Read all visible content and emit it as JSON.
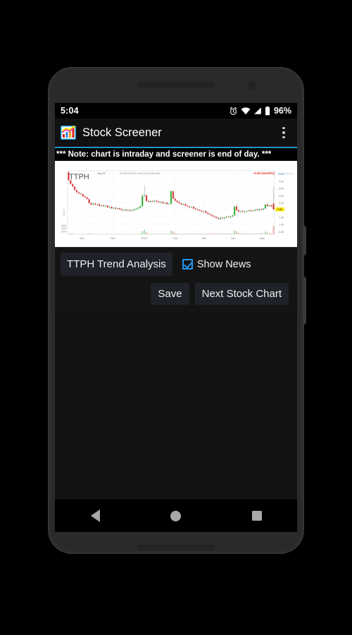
{
  "status_bar": {
    "clock": "5:04",
    "battery_percent": "96%",
    "icons": [
      "alarm-icon",
      "wifi-icon",
      "signal-icon",
      "battery-icon"
    ]
  },
  "app_bar": {
    "title": "Stock Screener",
    "app_icon": "stock-screener-app-icon",
    "overflow_icon": "overflow-menu-icon"
  },
  "note": {
    "text": "*** Note: chart is intraday and screener is end of day. ***",
    "accent_color": "#2196c4"
  },
  "controls": {
    "trend_analysis_label": "TTPH Trend Analysis",
    "show_news_label": "Show News",
    "show_news_checked": true,
    "save_label": "Save",
    "next_stock_chart_label": "Next Stock Chart",
    "checkbox_color": "#2196f3"
  },
  "nav_bar": {
    "back": "back-nav-icon",
    "home": "home-nav-icon",
    "recents": "recents-nav-icon"
  },
  "chart_data": {
    "type": "candlestick",
    "title": "TTPH",
    "subtitle": "DAILY",
    "quote_date": "May 08",
    "ohlc_label": "O:2.15  H:2.20  L:1.94  C:2.02  Vol:4.2M",
    "change_label": "-0.40 (16.53%)",
    "change_color": "#e03030",
    "source_label": "StockCharts.com",
    "last_price": "2.02",
    "price_axis_label": "Price",
    "price_ticks": [
      "4.50",
      "4.00",
      "3.50",
      "3.00",
      "2.50",
      "2.00",
      "1.50",
      "1.00",
      "0.50"
    ],
    "price_tick_values": [
      4.5,
      4.0,
      3.5,
      3.0,
      2.5,
      2.0,
      1.5,
      1.0,
      0.5
    ],
    "ylim": [
      0.3,
      4.7
    ],
    "volume_ticks": [
      "60M",
      "40M",
      "20M"
    ],
    "volume_tick_values": [
      60,
      40,
      20
    ],
    "x_tick_labels": [
      "Nov",
      "Dec",
      "2020",
      "Feb",
      "Mar",
      "Apr",
      "May"
    ],
    "x_tick_positions": [
      0.07,
      0.22,
      0.37,
      0.52,
      0.66,
      0.8,
      0.94
    ],
    "grid": true,
    "up_color": "#15a81c",
    "down_color": "#e02020",
    "candles": [
      {
        "o": 4.6,
        "h": 4.7,
        "l": 3.95,
        "c": 4.05
      },
      {
        "o": 4.05,
        "h": 4.1,
        "l": 3.7,
        "c": 3.78
      },
      {
        "o": 3.78,
        "h": 3.85,
        "l": 3.55,
        "c": 3.6
      },
      {
        "o": 3.6,
        "h": 3.66,
        "l": 3.3,
        "c": 3.36
      },
      {
        "o": 3.36,
        "h": 3.42,
        "l": 3.15,
        "c": 3.2
      },
      {
        "o": 3.2,
        "h": 3.28,
        "l": 3.05,
        "c": 3.12
      },
      {
        "o": 3.12,
        "h": 3.2,
        "l": 2.98,
        "c": 3.08
      },
      {
        "o": 3.08,
        "h": 3.15,
        "l": 2.88,
        "c": 2.92
      },
      {
        "o": 2.92,
        "h": 3.0,
        "l": 2.8,
        "c": 2.85
      },
      {
        "o": 2.85,
        "h": 2.95,
        "l": 2.7,
        "c": 2.74
      },
      {
        "o": 2.74,
        "h": 2.82,
        "l": 2.4,
        "c": 2.46
      },
      {
        "o": 2.46,
        "h": 2.55,
        "l": 2.3,
        "c": 2.36
      },
      {
        "o": 2.36,
        "h": 2.48,
        "l": 2.28,
        "c": 2.42
      },
      {
        "o": 2.42,
        "h": 2.5,
        "l": 2.3,
        "c": 2.34
      },
      {
        "o": 2.34,
        "h": 2.44,
        "l": 2.26,
        "c": 2.38
      },
      {
        "o": 2.38,
        "h": 2.46,
        "l": 2.22,
        "c": 2.26
      },
      {
        "o": 2.26,
        "h": 2.36,
        "l": 2.18,
        "c": 2.3
      },
      {
        "o": 2.3,
        "h": 2.38,
        "l": 2.2,
        "c": 2.24
      },
      {
        "o": 2.24,
        "h": 2.34,
        "l": 2.14,
        "c": 2.28
      },
      {
        "o": 2.28,
        "h": 2.35,
        "l": 2.12,
        "c": 2.16
      },
      {
        "o": 2.16,
        "h": 2.26,
        "l": 2.08,
        "c": 2.2
      },
      {
        "o": 2.2,
        "h": 2.28,
        "l": 2.05,
        "c": 2.09
      },
      {
        "o": 2.09,
        "h": 2.18,
        "l": 2.0,
        "c": 2.13
      },
      {
        "o": 2.13,
        "h": 2.22,
        "l": 2.02,
        "c": 2.06
      },
      {
        "o": 2.06,
        "h": 2.14,
        "l": 1.96,
        "c": 2.1
      },
      {
        "o": 2.1,
        "h": 2.18,
        "l": 1.98,
        "c": 2.02
      },
      {
        "o": 2.02,
        "h": 2.1,
        "l": 1.92,
        "c": 1.96
      },
      {
        "o": 1.96,
        "h": 2.04,
        "l": 1.88,
        "c": 2.0
      },
      {
        "o": 2.0,
        "h": 2.08,
        "l": 1.9,
        "c": 1.94
      },
      {
        "o": 1.94,
        "h": 2.02,
        "l": 1.86,
        "c": 1.98
      },
      {
        "o": 1.98,
        "h": 2.06,
        "l": 1.88,
        "c": 1.92
      },
      {
        "o": 1.92,
        "h": 2.0,
        "l": 1.84,
        "c": 1.96
      },
      {
        "o": 1.96,
        "h": 2.06,
        "l": 1.9,
        "c": 2.02
      },
      {
        "o": 2.02,
        "h": 2.12,
        "l": 1.96,
        "c": 2.08
      },
      {
        "o": 2.08,
        "h": 2.2,
        "l": 2.02,
        "c": 2.14
      },
      {
        "o": 2.14,
        "h": 2.28,
        "l": 2.08,
        "c": 2.24
      },
      {
        "o": 2.24,
        "h": 3.1,
        "l": 2.18,
        "c": 2.95
      },
      {
        "o": 2.95,
        "h": 3.7,
        "l": 2.88,
        "c": 3.0
      },
      {
        "o": 3.0,
        "h": 3.1,
        "l": 2.55,
        "c": 2.6
      },
      {
        "o": 2.6,
        "h": 2.7,
        "l": 2.48,
        "c": 2.54
      },
      {
        "o": 2.54,
        "h": 2.66,
        "l": 2.46,
        "c": 2.6
      },
      {
        "o": 2.6,
        "h": 2.7,
        "l": 2.5,
        "c": 2.56
      },
      {
        "o": 2.56,
        "h": 2.66,
        "l": 2.46,
        "c": 2.62
      },
      {
        "o": 2.62,
        "h": 2.72,
        "l": 2.52,
        "c": 2.56
      },
      {
        "o": 2.56,
        "h": 2.64,
        "l": 2.44,
        "c": 2.5
      },
      {
        "o": 2.5,
        "h": 2.6,
        "l": 2.42,
        "c": 2.54
      },
      {
        "o": 2.54,
        "h": 2.62,
        "l": 2.4,
        "c": 2.44
      },
      {
        "o": 2.44,
        "h": 2.54,
        "l": 2.36,
        "c": 2.48
      },
      {
        "o": 2.48,
        "h": 2.58,
        "l": 2.34,
        "c": 2.38
      },
      {
        "o": 2.38,
        "h": 2.48,
        "l": 2.3,
        "c": 2.42
      },
      {
        "o": 2.42,
        "h": 3.4,
        "l": 2.36,
        "c": 3.28
      },
      {
        "o": 3.28,
        "h": 3.36,
        "l": 2.7,
        "c": 2.76
      },
      {
        "o": 2.76,
        "h": 2.86,
        "l": 2.58,
        "c": 2.62
      },
      {
        "o": 2.62,
        "h": 2.7,
        "l": 2.48,
        "c": 2.52
      },
      {
        "o": 2.52,
        "h": 2.62,
        "l": 2.4,
        "c": 2.44
      },
      {
        "o": 2.44,
        "h": 2.52,
        "l": 2.32,
        "c": 2.36
      },
      {
        "o": 2.36,
        "h": 2.46,
        "l": 2.28,
        "c": 2.4
      },
      {
        "o": 2.4,
        "h": 2.48,
        "l": 2.24,
        "c": 2.28
      },
      {
        "o": 2.28,
        "h": 2.38,
        "l": 2.18,
        "c": 2.22
      },
      {
        "o": 2.22,
        "h": 2.32,
        "l": 2.12,
        "c": 2.16
      },
      {
        "o": 2.16,
        "h": 2.26,
        "l": 2.08,
        "c": 2.2
      },
      {
        "o": 2.2,
        "h": 2.28,
        "l": 2.04,
        "c": 2.08
      },
      {
        "o": 2.08,
        "h": 2.16,
        "l": 1.98,
        "c": 2.02
      },
      {
        "o": 2.02,
        "h": 2.12,
        "l": 1.94,
        "c": 1.98
      },
      {
        "o": 1.98,
        "h": 2.06,
        "l": 1.88,
        "c": 1.92
      },
      {
        "o": 1.92,
        "h": 2.0,
        "l": 1.82,
        "c": 1.86
      },
      {
        "o": 1.86,
        "h": 1.96,
        "l": 1.78,
        "c": 1.9
      },
      {
        "o": 1.9,
        "h": 1.98,
        "l": 1.74,
        "c": 1.78
      },
      {
        "o": 1.78,
        "h": 1.86,
        "l": 1.66,
        "c": 1.7
      },
      {
        "o": 1.7,
        "h": 1.8,
        "l": 1.6,
        "c": 1.64
      },
      {
        "o": 1.64,
        "h": 1.72,
        "l": 1.52,
        "c": 1.56
      },
      {
        "o": 1.56,
        "h": 1.66,
        "l": 1.46,
        "c": 1.5
      },
      {
        "o": 1.5,
        "h": 1.6,
        "l": 1.38,
        "c": 1.42
      },
      {
        "o": 1.42,
        "h": 1.52,
        "l": 1.32,
        "c": 1.36
      },
      {
        "o": 1.36,
        "h": 1.48,
        "l": 1.28,
        "c": 1.44
      },
      {
        "o": 1.44,
        "h": 1.54,
        "l": 1.36,
        "c": 1.4
      },
      {
        "o": 1.4,
        "h": 1.5,
        "l": 1.3,
        "c": 1.46
      },
      {
        "o": 1.46,
        "h": 1.58,
        "l": 1.4,
        "c": 1.52
      },
      {
        "o": 1.52,
        "h": 1.62,
        "l": 1.44,
        "c": 1.48
      },
      {
        "o": 1.48,
        "h": 1.58,
        "l": 1.38,
        "c": 1.54
      },
      {
        "o": 1.54,
        "h": 1.66,
        "l": 1.48,
        "c": 1.6
      },
      {
        "o": 1.6,
        "h": 2.3,
        "l": 1.56,
        "c": 2.22
      },
      {
        "o": 2.22,
        "h": 2.4,
        "l": 1.9,
        "c": 1.96
      },
      {
        "o": 1.96,
        "h": 2.06,
        "l": 1.82,
        "c": 1.86
      },
      {
        "o": 1.86,
        "h": 1.96,
        "l": 1.74,
        "c": 1.9
      },
      {
        "o": 1.9,
        "h": 2.0,
        "l": 1.8,
        "c": 1.84
      },
      {
        "o": 1.84,
        "h": 1.94,
        "l": 1.76,
        "c": 1.88
      },
      {
        "o": 1.88,
        "h": 1.98,
        "l": 1.8,
        "c": 1.92
      },
      {
        "o": 1.92,
        "h": 2.02,
        "l": 1.84,
        "c": 1.96
      },
      {
        "o": 1.96,
        "h": 2.04,
        "l": 1.86,
        "c": 1.9
      },
      {
        "o": 1.9,
        "h": 2.0,
        "l": 1.82,
        "c": 1.94
      },
      {
        "o": 1.94,
        "h": 2.06,
        "l": 1.88,
        "c": 2.0
      },
      {
        "o": 2.0,
        "h": 2.1,
        "l": 1.92,
        "c": 1.96
      },
      {
        "o": 1.96,
        "h": 2.08,
        "l": 1.9,
        "c": 2.04
      },
      {
        "o": 2.04,
        "h": 2.14,
        "l": 1.96,
        "c": 2.0
      },
      {
        "o": 2.0,
        "h": 2.12,
        "l": 1.94,
        "c": 2.08
      },
      {
        "o": 2.08,
        "h": 2.42,
        "l": 2.02,
        "c": 2.36
      },
      {
        "o": 2.36,
        "h": 2.5,
        "l": 2.2,
        "c": 2.26
      },
      {
        "o": 2.26,
        "h": 2.36,
        "l": 2.14,
        "c": 2.3
      },
      {
        "o": 2.3,
        "h": 2.4,
        "l": 2.18,
        "c": 2.22
      },
      {
        "o": 2.42,
        "h": 3.6,
        "l": 2.0,
        "c": 2.02
      }
    ],
    "volumes": [
      4,
      6,
      3,
      3,
      2,
      2,
      2,
      3,
      2,
      2,
      5,
      4,
      3,
      2,
      2,
      3,
      2,
      2,
      2,
      3,
      2,
      2,
      2,
      2,
      2,
      2,
      3,
      2,
      2,
      2,
      2,
      2,
      2,
      3,
      3,
      4,
      22,
      30,
      14,
      6,
      4,
      3,
      3,
      4,
      3,
      3,
      3,
      3,
      3,
      4,
      26,
      18,
      8,
      5,
      4,
      4,
      3,
      4,
      4,
      4,
      3,
      4,
      4,
      4,
      4,
      5,
      4,
      5,
      6,
      6,
      6,
      6,
      7,
      6,
      5,
      5,
      5,
      5,
      5,
      5,
      5,
      28,
      20,
      9,
      7,
      6,
      6,
      5,
      5,
      5,
      5,
      6,
      5,
      6,
      6,
      5,
      18,
      12,
      8,
      7,
      58
    ]
  }
}
